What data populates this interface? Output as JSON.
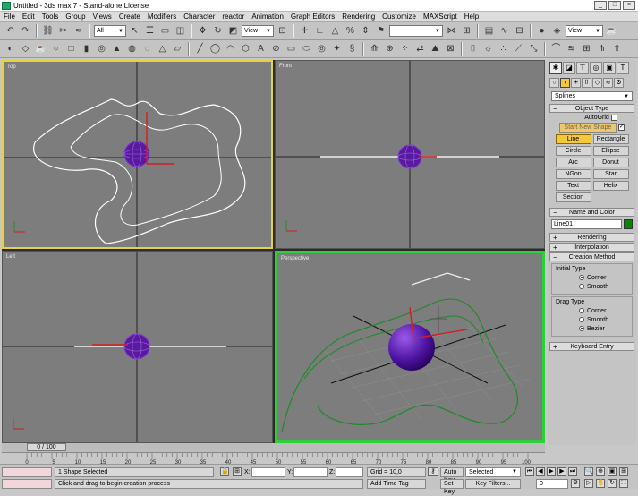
{
  "window": {
    "title": "Untitled - 3ds max 7 - Stand-alone License",
    "buttons": [
      "_",
      "□",
      "×"
    ]
  },
  "menu": [
    "File",
    "Edit",
    "Tools",
    "Group",
    "Views",
    "Create",
    "Modifiers",
    "Character",
    "reactor",
    "Animation",
    "Graph Editors",
    "Rendering",
    "Customize",
    "MAXScript",
    "Help"
  ],
  "toolbar": {
    "selection_filter": "All",
    "ref_coord": "View",
    "named_selection": "",
    "render_type": "View"
  },
  "viewports": {
    "top": "Top",
    "front": "Front",
    "left": "Left",
    "perspective": "Perspective"
  },
  "command_panel": {
    "category": "Splines",
    "object_type_title": "Object Type",
    "autogrid_label": "AutoGrid",
    "start_new_shape": "Start New Shape",
    "buttons": [
      [
        "Line",
        "Rectangle"
      ],
      [
        "Circle",
        "Ellipse"
      ],
      [
        "Arc",
        "Donut"
      ],
      [
        "NGon",
        "Star"
      ],
      [
        "Text",
        "Helix"
      ],
      [
        "Section",
        ""
      ]
    ],
    "name_color_title": "Name and Color",
    "object_name": "Line01",
    "object_color": "#008a00",
    "rendering_title": "Rendering",
    "interpolation_title": "Interpolation",
    "creation_method_title": "Creation Method",
    "initial_type_label": "Initial Type",
    "initial_options": [
      "Corner",
      "Smooth"
    ],
    "initial_selected": "Corner",
    "drag_type_label": "Drag Type",
    "drag_options": [
      "Corner",
      "Smooth",
      "Bezier"
    ],
    "drag_selected": "Bezier",
    "keyboard_entry_title": "Keyboard Entry"
  },
  "timeline": {
    "slider_label": "0 / 100",
    "ticks": [
      "0",
      "5",
      "10",
      "15",
      "20",
      "25",
      "30",
      "35",
      "40",
      "45",
      "50",
      "55",
      "60",
      "65",
      "70",
      "75",
      "80",
      "85",
      "90",
      "95",
      "100"
    ]
  },
  "status": {
    "selection_info": "1 Shape Selected",
    "prompt": "Click and drag to begin creation process",
    "x_label": "X:",
    "y_label": "Y:",
    "z_label": "Z:",
    "grid": "Grid = 10,0",
    "add_time_tag": "Add Time Tag",
    "auto_key": "Auto Key",
    "set_key": "Set Key",
    "key_mode": "Selected",
    "key_filters": "Key Filters...",
    "frame": "0"
  },
  "colors": {
    "active_viewport": "#e6d23a",
    "perspective_border": "#2ed03a",
    "sphere": "#5a1aa0",
    "spline_top": "#ffffff",
    "spline_persp": "#1f8a2a"
  }
}
